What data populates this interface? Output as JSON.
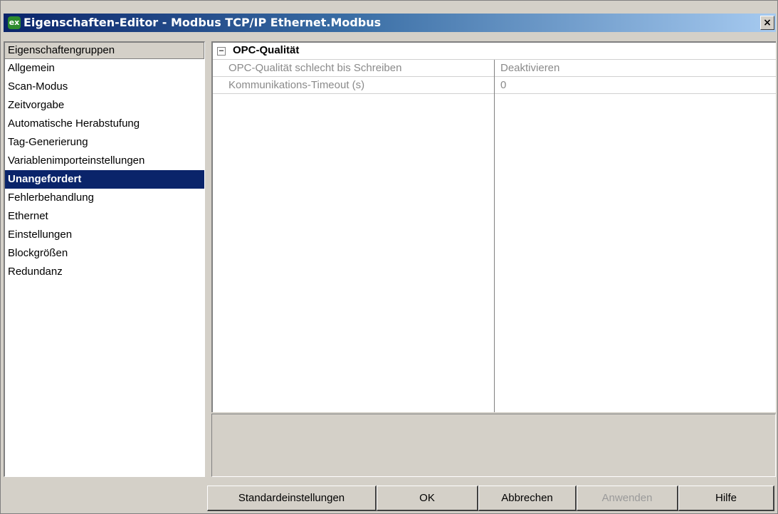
{
  "window": {
    "title": "Eigenschaften-Editor - Modbus TCP/IP Ethernet.Modbus",
    "app_icon": "ex",
    "close_label": "×"
  },
  "groups": {
    "header": "Eigenschaftengruppen",
    "items": [
      {
        "label": "Allgemein",
        "selected": false
      },
      {
        "label": "Scan-Modus",
        "selected": false
      },
      {
        "label": "Zeitvorgabe",
        "selected": false
      },
      {
        "label": "Automatische Herabstufung",
        "selected": false
      },
      {
        "label": "Tag-Generierung",
        "selected": false
      },
      {
        "label": "Variablenimporteinstellungen",
        "selected": false
      },
      {
        "label": "Unangefordert",
        "selected": true
      },
      {
        "label": "Fehlerbehandlung",
        "selected": false
      },
      {
        "label": "Ethernet",
        "selected": false
      },
      {
        "label": "Einstellungen",
        "selected": false
      },
      {
        "label": "Blockgrößen",
        "selected": false
      },
      {
        "label": "Redundanz",
        "selected": false
      }
    ]
  },
  "property_grid": {
    "collapse_symbol": "−",
    "section_title": "OPC-Qualität",
    "rows": [
      {
        "name": "OPC-Qualität schlecht bis Schreiben",
        "value": "Deaktivieren"
      },
      {
        "name": "Kommunikations-Timeout (s)",
        "value": "0"
      }
    ]
  },
  "buttons": {
    "defaults": "Standardeinstellungen",
    "ok": "OK",
    "cancel": "Abbrechen",
    "apply": "Anwenden",
    "help": "Hilfe"
  },
  "colors": {
    "selection": "#0a246a",
    "dialog_bg": "#d4d0c8",
    "disabled_text": "#8a8a8a"
  }
}
